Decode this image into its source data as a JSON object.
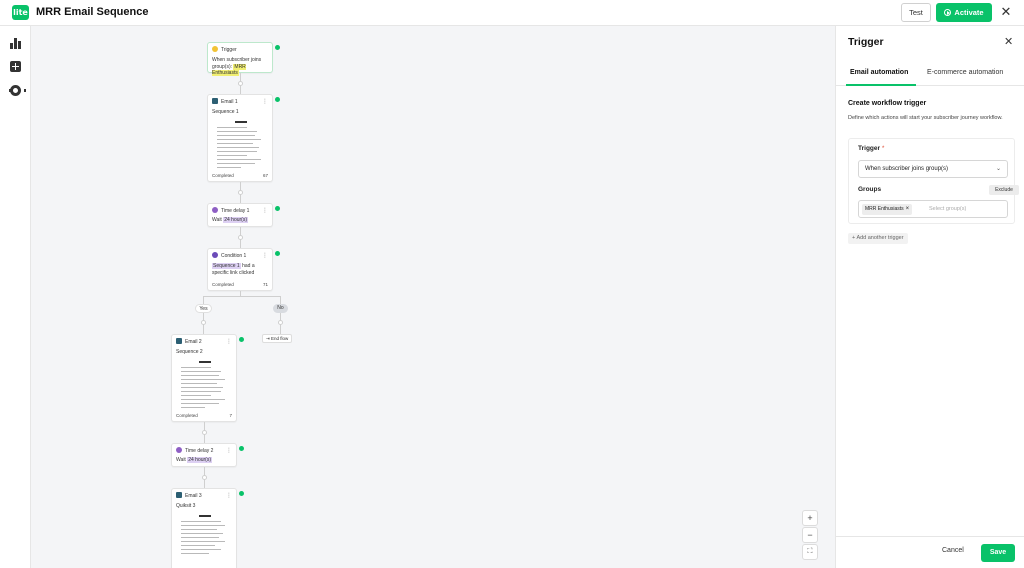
{
  "header": {
    "logo_text": "lite",
    "title": "MRR Email Sequence",
    "test_label": "Test",
    "activate_label": "Activate"
  },
  "rail": {
    "icons": [
      "bar-chart-icon",
      "add-square-icon",
      "gear-icon"
    ]
  },
  "workflow": {
    "trigger": {
      "label": "Trigger",
      "text": "When subscriber joins group(s):",
      "group": "MRR Enthusiasts"
    },
    "email1": {
      "label": "Email 1",
      "subject": "Sequence 1",
      "status": "Completed",
      "count": "67"
    },
    "delay1": {
      "label": "Time delay 1",
      "prefix": "Wait",
      "value": "24 hour(s)"
    },
    "condition1": {
      "label": "Condition 1",
      "highlight": "Sequence 1",
      "text": "had a specific link clicked",
      "status": "Completed",
      "count": "71"
    },
    "yes_label": "Yes",
    "no_label": "No",
    "end_flow": "End flow",
    "email2": {
      "label": "Email 2",
      "subject": "Sequence 2",
      "status": "Completed",
      "count": "7"
    },
    "delay2": {
      "label": "Time delay 2",
      "prefix": "Wait",
      "value": "24 hour(s)"
    },
    "email3": {
      "label": "Email 3",
      "subject": "Quiksit 3"
    }
  },
  "zoom": {
    "in": "+",
    "out": "−",
    "fit": "⛶"
  },
  "panel": {
    "title": "Trigger",
    "tabs": [
      {
        "label": "Email automation",
        "active": true
      },
      {
        "label": "E-commerce automation",
        "active": false
      }
    ],
    "section_title": "Create workflow trigger",
    "section_desc": "Define which actions will start your subscriber journey workflow.",
    "trigger_label": "Trigger",
    "trigger_required": "*",
    "trigger_value": "When subscriber joins group(s)",
    "groups_label": "Groups",
    "exclude_label": "Exclude",
    "group_chip": "MRR Enthusiasts",
    "groups_placeholder": "Select group(s)",
    "add_trigger": "Add another trigger",
    "cancel_label": "Cancel",
    "save_label": "Save"
  },
  "colors": {
    "brand": "#09c269",
    "highlight_yellow": "#f1ef73",
    "highlight_purple": "#ddd0f3"
  }
}
